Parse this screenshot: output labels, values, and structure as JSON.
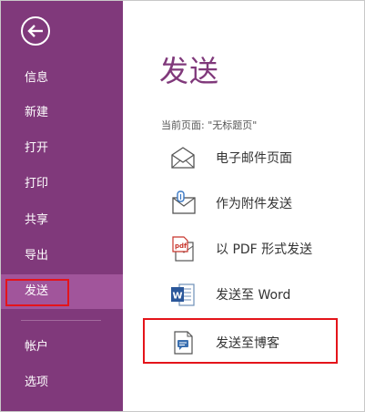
{
  "sidebar": {
    "back_icon": "back-arrow-icon",
    "items": [
      {
        "label": "信息"
      },
      {
        "label": "新建"
      },
      {
        "label": "打开"
      },
      {
        "label": "打印"
      },
      {
        "label": "共享"
      },
      {
        "label": "导出"
      },
      {
        "label": "发送",
        "active": true
      },
      {
        "label": "帐户"
      },
      {
        "label": "选项"
      }
    ]
  },
  "main": {
    "title": "发送",
    "current_page": "当前页面: \"无标题页\"",
    "actions": [
      {
        "label": "电子邮件页面",
        "icon": "envelope-icon"
      },
      {
        "label": "作为附件发送",
        "icon": "attachment-icon"
      },
      {
        "label": "以 PDF 形式发送",
        "icon": "pdf-icon"
      },
      {
        "label": "发送至 Word",
        "icon": "word-icon"
      },
      {
        "label": "发送至博客",
        "icon": "blog-icon"
      }
    ]
  },
  "colors": {
    "sidebar_bg": "#80397b",
    "sidebar_active": "#a1559b",
    "title_color": "#80397b",
    "annotation_red": "#e4141a"
  }
}
